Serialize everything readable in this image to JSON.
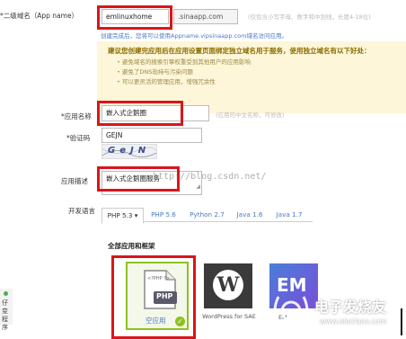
{
  "domain_row": {
    "label": "*二级域名（App name）",
    "value": "emlinuxhome",
    "suffix": ".sinaapp.com",
    "hint": "(仅包含小写字母、数字和中划线，长度4-18位)",
    "sub_text": "创建完成后，您将可以使用Appname.vipsinaapp.com域名访问应用。"
  },
  "notice": {
    "title": "建议您创建完应用后在应用设置页面绑定独立域名用于服务，使用独立域名有以下好处：",
    "items": [
      "避免域名的搜索引擎权重受到其他用户的应用影响",
      "避免了DNS劫持与污染问题",
      "可以更灵活的管理应用，增强冗余性"
    ]
  },
  "app_name": {
    "label": "*应用名称",
    "value": "嵌入式企鹅圈",
    "hint": "(应用的中文名称，可修改)"
  },
  "captcha": {
    "label": "*验证码",
    "value": "GEJN",
    "image_text": "GeJN"
  },
  "app_desc": {
    "label": "应用描述",
    "value": "嵌入式企鹅圈服务"
  },
  "dev_lang": {
    "label": "开发语言",
    "tabs": [
      "PHP 5.3 ▾",
      "PHP 5.6",
      "Python 2.7",
      "Java 1.6",
      "Java 1.7"
    ]
  },
  "apps": {
    "section_title": "全部应用和框架",
    "items": [
      {
        "name": "空应用",
        "icon_label": "PHP",
        "icon_small": "<?PHP ?>"
      },
      {
        "name": "WordPress for SAE",
        "icon_label": "W"
      },
      {
        "name": "EM",
        "icon_label": "EM"
      }
    ]
  },
  "sidebar_text": "仔变程序",
  "watermark": "http://blog.csdn.net/",
  "brand_watermark": {
    "title": "电子发烧友",
    "url": "www.elecfans.com"
  },
  "colors": {
    "red": "#d8161b",
    "link": "#4a79c4",
    "notice_bg": "#fdf6d8",
    "green": "#8dc21f"
  }
}
